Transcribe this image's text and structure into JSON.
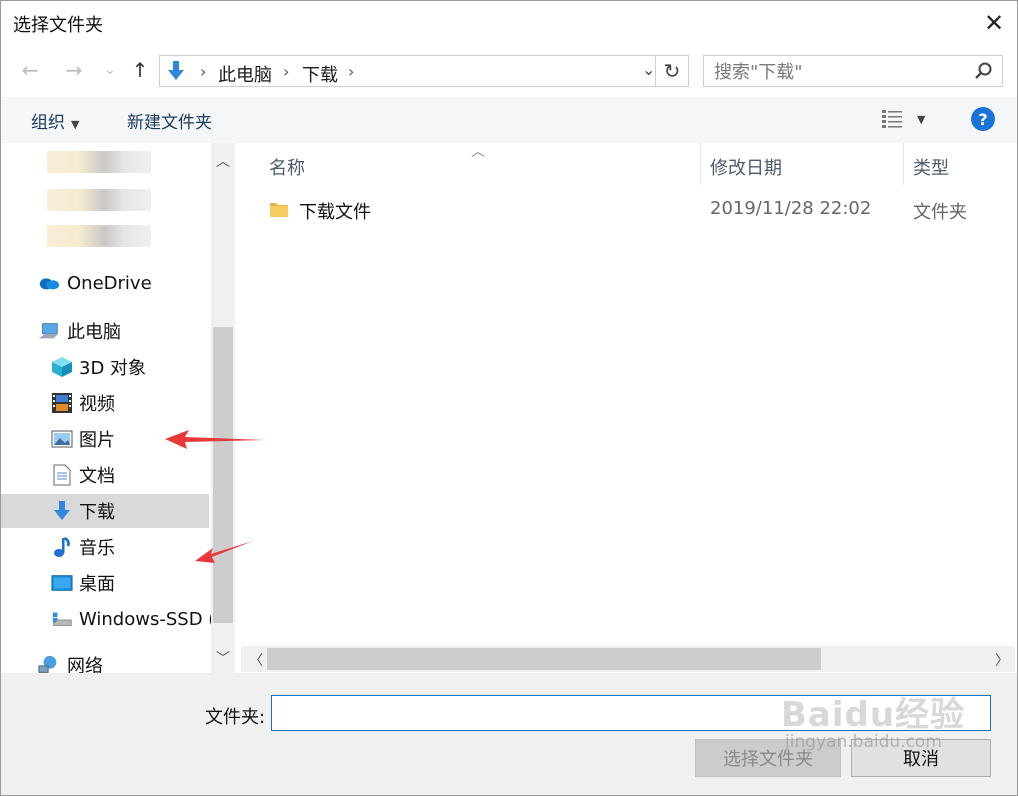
{
  "window": {
    "title": "选择文件夹"
  },
  "nav": {
    "back_glyph": "←",
    "forward_glyph": "→",
    "recent_glyph": "⌄",
    "up_glyph": "↑"
  },
  "address": {
    "crumbs": [
      "此电脑",
      "下载"
    ],
    "separator": "›",
    "refresh_glyph": "↻"
  },
  "search": {
    "placeholder": "搜索\"下载\""
  },
  "toolbar": {
    "organize_label": "组织",
    "new_folder_label": "新建文件夹",
    "help_label": "?"
  },
  "sidebar": {
    "items": [
      {
        "label": "OneDrive",
        "icon": "onedrive-cloud-icon"
      },
      {
        "label": "此电脑",
        "icon": "this-pc-icon"
      },
      {
        "label": "3D 对象",
        "icon": "3d-objects-icon"
      },
      {
        "label": "视频",
        "icon": "video-film-icon"
      },
      {
        "label": "图片",
        "icon": "pictures-icon"
      },
      {
        "label": "文档",
        "icon": "documents-icon"
      },
      {
        "label": "下载",
        "icon": "download-arrow-icon",
        "selected": true
      },
      {
        "label": "音乐",
        "icon": "music-note-icon"
      },
      {
        "label": "桌面",
        "icon": "desktop-icon"
      },
      {
        "label": "Windows-SSD (",
        "icon": "drive-icon"
      },
      {
        "label": "网络",
        "icon": "network-icon"
      }
    ]
  },
  "filelist": {
    "columns": [
      "名称",
      "修改日期",
      "类型"
    ],
    "rows": [
      {
        "name": "下载文件",
        "date": "2019/11/28 22:02",
        "type": "文件夹"
      }
    ]
  },
  "bottom": {
    "folder_label": "文件夹:",
    "folder_value": "",
    "select_button": "选择文件夹",
    "cancel_button": "取消"
  },
  "watermark": {
    "brand": "Baidu经验",
    "url": "jingyan.baidu.com"
  },
  "colors": {
    "accent": "#1a73d9",
    "selected_bg": "#d9d9d9",
    "annotation_red": "#e8383a",
    "folder_yellow": "#f2c14e"
  }
}
